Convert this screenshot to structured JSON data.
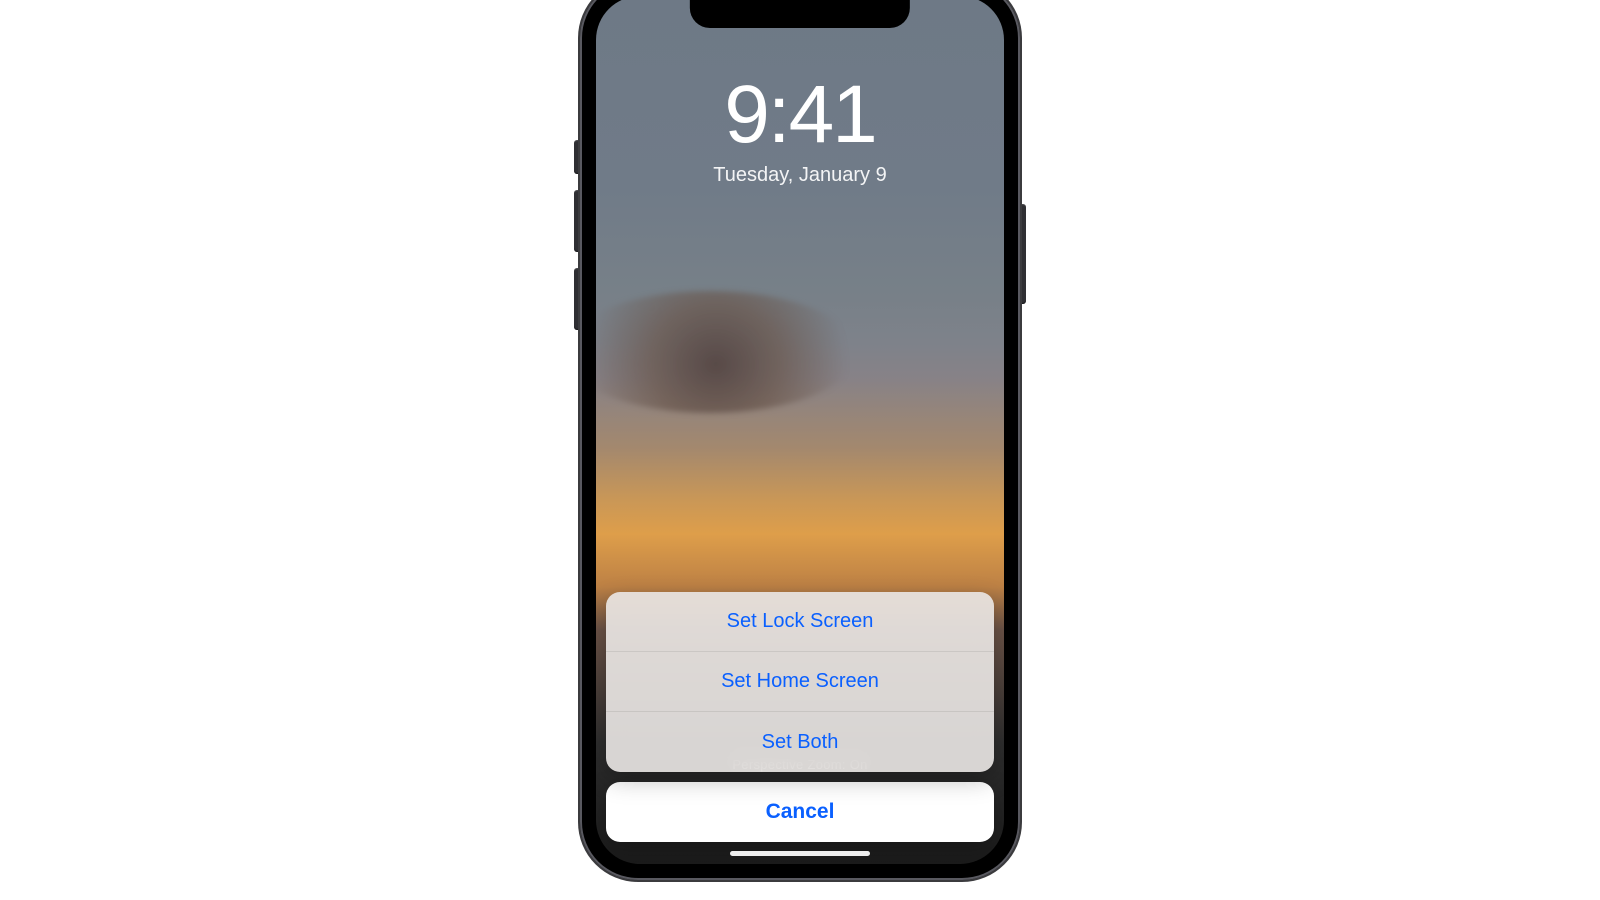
{
  "lockscreen": {
    "time": "9:41",
    "date": "Tuesday, January 9"
  },
  "perspective_zoom_label": "Perspective Zoom: On",
  "action_sheet": {
    "set_lock": "Set Lock Screen",
    "set_home": "Set Home Screen",
    "set_both": "Set Both",
    "cancel": "Cancel"
  },
  "colors": {
    "ios_blue": "#0a60ff"
  }
}
